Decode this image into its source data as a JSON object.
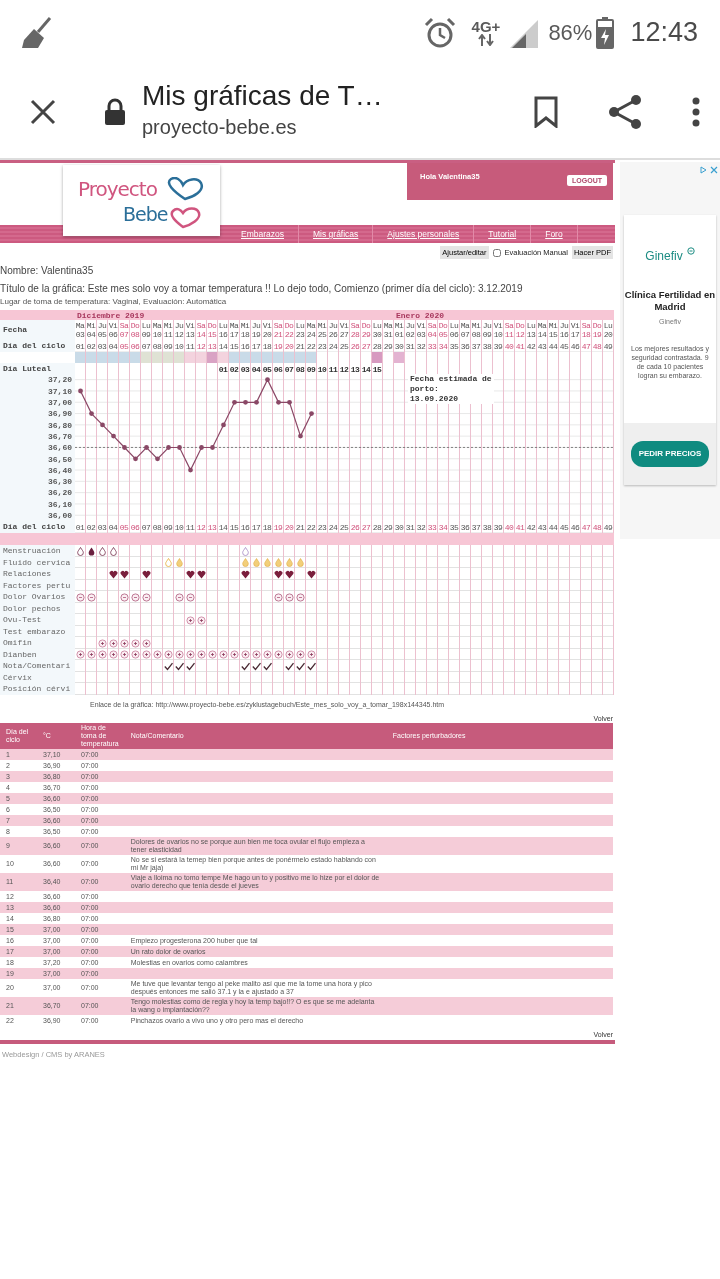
{
  "status_bar": {
    "network": "4G+",
    "battery": "86%",
    "time": "12:43"
  },
  "browser": {
    "title": "Mis gráficas de T…",
    "url": "proyecto-bebe.es"
  },
  "site": {
    "logo": {
      "line1": "Proyecto",
      "line2": "Bebe"
    },
    "greeting": "Hola Valentina35",
    "logout": "LOGOUT",
    "nav": [
      "Embarazos",
      "Mis gráficas",
      "Ajustes personales",
      "Tutorial",
      "Foro"
    ]
  },
  "toolbar": {
    "edit": "Ajustar/editar",
    "manual_eval": {
      "label": "Evaluación Manual",
      "checked": false
    },
    "pdf": "Hacer PDF"
  },
  "info": {
    "name": "Nombre: Valentina35",
    "title": "Título de la gráfica: Este mes solo voy a tomar temperatura !! Lo dejo todo, Comienzo (primer día del ciclo): 3.12.2019",
    "place": "Lugar de toma de temperatura: Vaginal, Evaluación: Automática"
  },
  "chart": {
    "row_labels": {
      "date": "Fecha",
      "cycle_day": "Día del ciclo",
      "luteal": "Día Luteal",
      "cycle_day_repeat": "Día del ciclo"
    },
    "days": [
      {
        "weekday": "Ma",
        "date": "03",
        "cycle_day": "01",
        "cycle_day_repeat": "01",
        "weekend": false,
        "month": "Diciembre 2019",
        "color": "#c9dbe8"
      },
      {
        "weekday": "Mi",
        "date": "04",
        "cycle_day": "02",
        "cycle_day_repeat": "02",
        "weekend": false,
        "color": "#c9dbe8"
      },
      {
        "weekday": "Ju",
        "date": "05",
        "cycle_day": "03",
        "cycle_day_repeat": "03",
        "weekend": false,
        "color": "#c9dbe8"
      },
      {
        "weekday": "Vi",
        "date": "06",
        "cycle_day": "04",
        "cycle_day_repeat": "04",
        "weekend": false,
        "color": "#c9dbe8"
      },
      {
        "weekday": "Sa",
        "date": "07",
        "cycle_day": "05",
        "cycle_day_repeat": "05",
        "weekend": true,
        "color": "#c9dbe8"
      },
      {
        "weekday": "Do",
        "date": "08",
        "cycle_day": "06",
        "cycle_day_repeat": "06",
        "weekend": true,
        "color": "#c9dbe8"
      },
      {
        "weekday": "Lu",
        "date": "09",
        "cycle_day": "07",
        "cycle_day_repeat": "07",
        "weekend": false,
        "color": "#dfe2d4"
      },
      {
        "weekday": "Ma",
        "date": "10",
        "cycle_day": "08",
        "cycle_day_repeat": "08",
        "weekend": false,
        "color": "#dfe2d4"
      },
      {
        "weekday": "Mi",
        "date": "11",
        "cycle_day": "09",
        "cycle_day_repeat": "09",
        "weekend": false,
        "color": "#dfe2d4"
      },
      {
        "weekday": "Ju",
        "date": "12",
        "cycle_day": "10",
        "cycle_day_repeat": "10",
        "weekend": false,
        "color": "#dfe2d4"
      },
      {
        "weekday": "Vi",
        "date": "13",
        "cycle_day": "11",
        "cycle_day_repeat": "11",
        "weekend": false,
        "color": "#f3d3de"
      },
      {
        "weekday": "Sa",
        "date": "14",
        "cycle_day": "12",
        "cycle_day_repeat": "12",
        "weekend": true,
        "color": "#f3d3de"
      },
      {
        "weekday": "Do",
        "date": "15",
        "cycle_day": "13",
        "cycle_day_repeat": "13",
        "weekend": true,
        "color": "#d9a3c4"
      },
      {
        "weekday": "Lu",
        "date": "16",
        "cycle_day": "14",
        "cycle_day_repeat": "14",
        "weekend": false,
        "color": "#f3d3de",
        "luteal_day": "01"
      },
      {
        "weekday": "Ma",
        "date": "17",
        "cycle_day": "15",
        "cycle_day_repeat": "15",
        "weekend": false,
        "color": "#c9dbe8",
        "luteal_day": "02"
      },
      {
        "weekday": "Mi",
        "date": "18",
        "cycle_day": "16",
        "cycle_day_repeat": "16",
        "weekend": false,
        "color": "#c9dbe8",
        "luteal_day": "03"
      },
      {
        "weekday": "Ju",
        "date": "19",
        "cycle_day": "17",
        "cycle_day_repeat": "17",
        "weekend": false,
        "color": "#c9dbe8",
        "luteal_day": "04"
      },
      {
        "weekday": "Vi",
        "date": "20",
        "cycle_day": "18",
        "cycle_day_repeat": "18",
        "weekend": false,
        "color": "#c9dbe8",
        "luteal_day": "05"
      },
      {
        "weekday": "Sa",
        "date": "21",
        "cycle_day": "19",
        "cycle_day_repeat": "19",
        "weekend": true,
        "color": "#c9dbe8",
        "luteal_day": "06"
      },
      {
        "weekday": "Do",
        "date": "22",
        "cycle_day": "20",
        "cycle_day_repeat": "20",
        "weekend": true,
        "color": "#c9dbe8",
        "luteal_day": "07"
      },
      {
        "weekday": "Lu",
        "date": "23",
        "cycle_day": "21",
        "cycle_day_repeat": "21",
        "weekend": false,
        "color": "#c9dbe8",
        "luteal_day": "08"
      },
      {
        "weekday": "Ma",
        "date": "24",
        "cycle_day": "22",
        "cycle_day_repeat": "22",
        "weekend": false,
        "color": "#c9dbe8",
        "luteal_day": "09"
      },
      {
        "weekday": "Mi",
        "date": "25",
        "cycle_day": "23",
        "cycle_day_repeat": "23",
        "weekend": false,
        "luteal_day": "10"
      },
      {
        "weekday": "Ju",
        "date": "26",
        "cycle_day": "24",
        "cycle_day_repeat": "24",
        "weekend": false,
        "luteal_day": "11"
      },
      {
        "weekday": "Vi",
        "date": "27",
        "cycle_day": "25",
        "cycle_day_repeat": "25",
        "weekend": false,
        "luteal_day": "12"
      },
      {
        "weekday": "Sa",
        "date": "28",
        "cycle_day": "26",
        "cycle_day_repeat": "26",
        "weekend": true,
        "luteal_day": "13"
      },
      {
        "weekday": "Do",
        "date": "29",
        "cycle_day": "27",
        "cycle_day_repeat": "27",
        "weekend": true,
        "luteal_day": "14"
      },
      {
        "weekday": "Lu",
        "date": "30",
        "cycle_day": "28",
        "cycle_day_repeat": "28",
        "weekend": false,
        "color": "#d79ac0",
        "luteal_day": "15"
      },
      {
        "weekday": "Ma",
        "date": "31",
        "cycle_day": "29",
        "cycle_day_repeat": "29",
        "weekend": false
      },
      {
        "weekday": "Mi",
        "date": "01",
        "cycle_day": "30",
        "cycle_day_repeat": "30",
        "weekend": false,
        "month": "Enero 2020",
        "color": "#e3b3d1"
      },
      {
        "weekday": "Ju",
        "date": "02",
        "cycle_day": "31",
        "cycle_day_repeat": "31",
        "weekend": false
      },
      {
        "weekday": "Vi",
        "date": "03",
        "cycle_day": "32",
        "cycle_day_repeat": "32",
        "weekend": false
      },
      {
        "weekday": "Sa",
        "date": "04",
        "cycle_day": "33",
        "cycle_day_repeat": "33",
        "weekend": true
      },
      {
        "weekday": "Do",
        "date": "05",
        "cycle_day": "34",
        "cycle_day_repeat": "34",
        "weekend": true
      },
      {
        "weekday": "Lu",
        "date": "06",
        "cycle_day": "35",
        "cycle_day_repeat": "35",
        "weekend": false
      },
      {
        "weekday": "Ma",
        "date": "07",
        "cycle_day": "36",
        "cycle_day_repeat": "36",
        "weekend": false
      },
      {
        "weekday": "Mi",
        "date": "08",
        "cycle_day": "37",
        "cycle_day_repeat": "37",
        "weekend": false
      },
      {
        "weekday": "Ju",
        "date": "09",
        "cycle_day": "38",
        "cycle_day_repeat": "38",
        "weekend": false
      },
      {
        "weekday": "Vi",
        "date": "10",
        "cycle_day": "39",
        "cycle_day_repeat": "39",
        "weekend": false
      },
      {
        "weekday": "Sa",
        "date": "11",
        "cycle_day": "40",
        "cycle_day_repeat": "40",
        "weekend": true
      },
      {
        "weekday": "Do",
        "date": "12",
        "cycle_day": "41",
        "cycle_day_repeat": "41",
        "weekend": true
      },
      {
        "weekday": "Lu",
        "date": "13",
        "cycle_day": "42",
        "cycle_day_repeat": "42",
        "weekend": false
      },
      {
        "weekday": "Ma",
        "date": "14",
        "cycle_day": "43",
        "cycle_day_repeat": "43",
        "weekend": false
      },
      {
        "weekday": "Mi",
        "date": "15",
        "cycle_day": "44",
        "cycle_day_repeat": "44",
        "weekend": false
      },
      {
        "weekday": "Ju",
        "date": "16",
        "cycle_day": "45",
        "cycle_day_repeat": "45",
        "weekend": false
      },
      {
        "weekday": "Vi",
        "date": "17",
        "cycle_day": "46",
        "cycle_day_repeat": "46",
        "weekend": false
      },
      {
        "weekday": "Sa",
        "date": "18",
        "cycle_day": "47",
        "cycle_day_repeat": "47",
        "weekend": true
      },
      {
        "weekday": "Do",
        "date": "19",
        "cycle_day": "48",
        "cycle_day_repeat": "48",
        "weekend": true
      },
      {
        "weekday": "Lu",
        "date": "20",
        "cycle_day": "49",
        "cycle_day_repeat": "49",
        "weekend": false
      }
    ],
    "due_date": {
      "label": "Fecha estimada de porto:",
      "date": "13.09.2020"
    },
    "chart_data": {
      "type": "line",
      "grid": true,
      "series": [
        {
          "color": "#8a4866",
          "values": [
            37.1,
            36.9,
            36.8,
            36.7,
            36.6,
            36.5,
            36.6,
            36.5,
            36.6,
            36.6,
            36.4,
            36.6,
            36.6,
            36.8,
            37.0,
            37.0,
            37.0,
            37.2,
            37.0,
            37.0,
            36.7,
            36.9,
            null,
            null,
            null,
            null,
            null,
            null,
            null,
            null,
            null,
            null,
            null,
            null,
            null,
            null,
            null,
            null,
            null,
            null,
            null,
            null,
            null,
            null,
            null,
            null,
            null,
            null,
            null
          ]
        }
      ],
      "ylim": [
        36.0,
        37.2
      ],
      "yticks": [
        {
          "value": 37.2,
          "label": "37,20"
        },
        {
          "value": 37.1,
          "label": "37,10"
        },
        {
          "value": 37.0,
          "label": "37,00"
        },
        {
          "value": 36.9,
          "label": "36,90"
        },
        {
          "value": 36.8,
          "label": "36,80"
        },
        {
          "value": 36.7,
          "label": "36,70"
        },
        {
          "value": 36.6,
          "label": "36,60"
        },
        {
          "value": 36.5,
          "label": "36,50"
        },
        {
          "value": 36.4,
          "label": "36,40"
        },
        {
          "value": 36.3,
          "label": "36,30"
        },
        {
          "value": 36.2,
          "label": "36,20"
        },
        {
          "value": 36.1,
          "label": "36,10"
        },
        {
          "value": 36.0,
          "label": "36,00"
        }
      ],
      "ref_lines": [
        {
          "axis": "y",
          "value": 36.6
        }
      ]
    },
    "symptoms": [
      {
        "label": "Menstruación",
        "cells": [
          {
            "kind": "drop"
          },
          {
            "kind": "drop-filled"
          },
          {
            "kind": "drop"
          },
          {
            "kind": "drop"
          },
          {
            "kind": "none"
          },
          {
            "kind": "none"
          },
          {
            "kind": "none"
          },
          {
            "kind": "none"
          },
          {
            "kind": "none"
          },
          {
            "kind": "none"
          },
          {
            "kind": "none"
          },
          {
            "kind": "none"
          },
          {
            "kind": "none"
          },
          {
            "kind": "none"
          },
          {
            "kind": "none"
          },
          {
            "kind": "drop-light"
          }
        ]
      },
      {
        "label": "Fluido cervica",
        "cells": [
          {
            "kind": "none"
          },
          {
            "kind": "none"
          },
          {
            "kind": "none"
          },
          {
            "kind": "none"
          },
          {
            "kind": "none"
          },
          {
            "kind": "none"
          },
          {
            "kind": "none"
          },
          {
            "kind": "none"
          },
          {
            "kind": "drop-yellow"
          },
          {
            "kind": "drop-yellow-filled"
          },
          {
            "kind": "none"
          },
          {
            "kind": "none"
          },
          {
            "kind": "none"
          },
          {
            "kind": "none"
          },
          {
            "kind": "none"
          },
          {
            "kind": "drop-yellow-filled"
          },
          {
            "kind": "drop-yellow-filled"
          },
          {
            "kind": "drop-yellow-filled"
          },
          {
            "kind": "drop-yellow-filled"
          },
          {
            "kind": "drop-yellow-filled"
          },
          {
            "kind": "drop-yellow-filled"
          }
        ]
      },
      {
        "label": "Relaciones",
        "cells": [
          {
            "kind": "none"
          },
          {
            "kind": "none"
          },
          {
            "kind": "none"
          },
          {
            "kind": "heart"
          },
          {
            "kind": "heart"
          },
          {
            "kind": "none"
          },
          {
            "kind": "heart"
          },
          {
            "kind": "none"
          },
          {
            "kind": "none"
          },
          {
            "kind": "none"
          },
          {
            "kind": "heart"
          },
          {
            "kind": "heart"
          },
          {
            "kind": "none"
          },
          {
            "kind": "none"
          },
          {
            "kind": "none"
          },
          {
            "kind": "heart"
          },
          {
            "kind": "none"
          },
          {
            "kind": "none"
          },
          {
            "kind": "heart"
          },
          {
            "kind": "heart"
          },
          {
            "kind": "none"
          },
          {
            "kind": "heart"
          }
        ]
      },
      {
        "label": "Factores pertu"
      },
      {
        "label": "Dolor Ovarios",
        "cells": [
          {
            "kind": "circle-dot"
          },
          {
            "kind": "circle-dot"
          },
          {
            "kind": "none"
          },
          {
            "kind": "none"
          },
          {
            "kind": "circle-dot"
          },
          {
            "kind": "circle-dot"
          },
          {
            "kind": "circle-dot"
          },
          {
            "kind": "none"
          },
          {
            "kind": "none"
          },
          {
            "kind": "circle-dot"
          },
          {
            "kind": "circle-dot"
          },
          {
            "kind": "none"
          },
          {
            "kind": "none"
          },
          {
            "kind": "none"
          },
          {
            "kind": "none"
          },
          {
            "kind": "none"
          },
          {
            "kind": "none"
          },
          {
            "kind": "none"
          },
          {
            "kind": "circle-dot"
          },
          {
            "kind": "circle-dot"
          },
          {
            "kind": "circle-dot"
          }
        ]
      },
      {
        "label": "Dolor pechos"
      },
      {
        "label": "Ovu-Test",
        "cells": [
          {
            "kind": "none"
          },
          {
            "kind": "none"
          },
          {
            "kind": "none"
          },
          {
            "kind": "none"
          },
          {
            "kind": "none"
          },
          {
            "kind": "none"
          },
          {
            "kind": "none"
          },
          {
            "kind": "none"
          },
          {
            "kind": "none"
          },
          {
            "kind": "none"
          },
          {
            "kind": "circle-plus"
          },
          {
            "kind": "circle-plus"
          }
        ]
      },
      {
        "label": "Test embarazo"
      },
      {
        "label": "Omifin",
        "cells": [
          {
            "kind": "none"
          },
          {
            "kind": "none"
          },
          {
            "kind": "circle-plus"
          },
          {
            "kind": "circle-plus"
          },
          {
            "kind": "circle-plus"
          },
          {
            "kind": "circle-plus"
          },
          {
            "kind": "circle-plus"
          }
        ]
      },
      {
        "label": "Dianben",
        "cells": [
          {
            "kind": "circle-plus"
          },
          {
            "kind": "circle-plus"
          },
          {
            "kind": "circle-plus"
          },
          {
            "kind": "circle-plus"
          },
          {
            "kind": "circle-plus"
          },
          {
            "kind": "circle-plus"
          },
          {
            "kind": "circle-plus"
          },
          {
            "kind": "circle-plus"
          },
          {
            "kind": "circle-plus"
          },
          {
            "kind": "circle-plus"
          },
          {
            "kind": "circle-plus"
          },
          {
            "kind": "circle-plus"
          },
          {
            "kind": "circle-plus"
          },
          {
            "kind": "circle-plus"
          },
          {
            "kind": "circle-plus"
          },
          {
            "kind": "circle-plus"
          },
          {
            "kind": "circle-plus"
          },
          {
            "kind": "circle-plus"
          },
          {
            "kind": "circle-plus"
          },
          {
            "kind": "circle-plus"
          },
          {
            "kind": "circle-plus"
          },
          {
            "kind": "circle-plus"
          }
        ]
      },
      {
        "label": "Nota/Comentari",
        "cells": [
          {
            "kind": "none"
          },
          {
            "kind": "none"
          },
          {
            "kind": "none"
          },
          {
            "kind": "none"
          },
          {
            "kind": "none"
          },
          {
            "kind": "none"
          },
          {
            "kind": "none"
          },
          {
            "kind": "none"
          },
          {
            "kind": "check"
          },
          {
            "kind": "check"
          },
          {
            "kind": "check"
          },
          {
            "kind": "none"
          },
          {
            "kind": "none"
          },
          {
            "kind": "none"
          },
          {
            "kind": "none"
          },
          {
            "kind": "check"
          },
          {
            "kind": "check"
          },
          {
            "kind": "check"
          },
          {
            "kind": "none"
          },
          {
            "kind": "check"
          },
          {
            "kind": "check"
          },
          {
            "kind": "check"
          }
        ]
      },
      {
        "label": "Cérvix"
      },
      {
        "label": "Posición cérvi"
      }
    ]
  },
  "link": {
    "label": "Enlace de la gráfica:",
    "url": "http://www.proyecto-bebe.es/zyklustagebuch/Este_mes_solo_voy_a_tomar_198x144345.htm"
  },
  "back_top": "Volver",
  "table": {
    "columns": [
      "Día del ciclo",
      "°C",
      "Hora de toma de temperatura",
      "Nota/Comentario",
      "Factores perturbadores"
    ],
    "rows": [
      {
        "day": "1",
        "temp": "37,10",
        "time": "07:00"
      },
      {
        "day": "2",
        "temp": "36,90",
        "time": "07:00"
      },
      {
        "day": "3",
        "temp": "36,80",
        "time": "07:00"
      },
      {
        "day": "4",
        "temp": "36,70",
        "time": "07:00"
      },
      {
        "day": "5",
        "temp": "36,60",
        "time": "07:00"
      },
      {
        "day": "6",
        "temp": "36,50",
        "time": "07:00"
      },
      {
        "day": "7",
        "temp": "36,60",
        "time": "07:00"
      },
      {
        "day": "8",
        "temp": "36,50",
        "time": "07:00"
      },
      {
        "day": "9",
        "temp": "36,60",
        "time": "07:00",
        "note": "Dolores de ovarios no se porque aun bien me toca ovular el flujo empieza a tener elasticidad"
      },
      {
        "day": "10",
        "temp": "36,60",
        "time": "07:00",
        "note": "No se si estará la temep bien porque antes de ponérmelo estado hablando con mi Mr jaja)"
      },
      {
        "day": "11",
        "temp": "36,40",
        "time": "07:00",
        "note": "Viaje a lloima no tomo tempe Me hago un to y positivo me lo hize por el dolor de ovario derecho que tenía desde el jueves"
      },
      {
        "day": "12",
        "temp": "36,60",
        "time": "07:00"
      },
      {
        "day": "13",
        "temp": "36,60",
        "time": "07:00"
      },
      {
        "day": "14",
        "temp": "36,80",
        "time": "07:00"
      },
      {
        "day": "15",
        "temp": "37,00",
        "time": "07:00"
      },
      {
        "day": "16",
        "temp": "37,00",
        "time": "07:00",
        "note": "Empiezo progesterona 200 huber que tal"
      },
      {
        "day": "17",
        "temp": "37,00",
        "time": "07:00",
        "note": "Un rato dolor de ovarios"
      },
      {
        "day": "18",
        "temp": "37,20",
        "time": "07:00",
        "note": "Molestias en ovarios como calambres"
      },
      {
        "day": "19",
        "temp": "37,00",
        "time": "07:00"
      },
      {
        "day": "20",
        "temp": "37,00",
        "time": "07:00",
        "note": "Me tuve que levantar tengo al peke malito así que me la tome una hora y pico después entonces me salió 37.1 y la e ajustado a 37"
      },
      {
        "day": "21",
        "temp": "36,70",
        "time": "07:00",
        "note": "Tengo molestias como de regla y hoy la temp bajo!!? O es que se me adelanta la wang o implantación??"
      },
      {
        "day": "22",
        "temp": "36,90",
        "time": "07:00",
        "note": "Pinchazos ovario a vivo uno y otro pero mas el derecho"
      }
    ]
  },
  "back_bottom": "Volver",
  "footer": "Webdesign / CMS by ARANES",
  "ad": {
    "brand": "Ginefiv",
    "headline": "Clínica Fertilidad en Madrid",
    "advertiser": "Ginefiv",
    "body": "Los mejores resultados y seguridad contrastada. 9 de cada 10 pacientes logran su embarazo.",
    "cta": "PEDIR PRECIOS"
  }
}
